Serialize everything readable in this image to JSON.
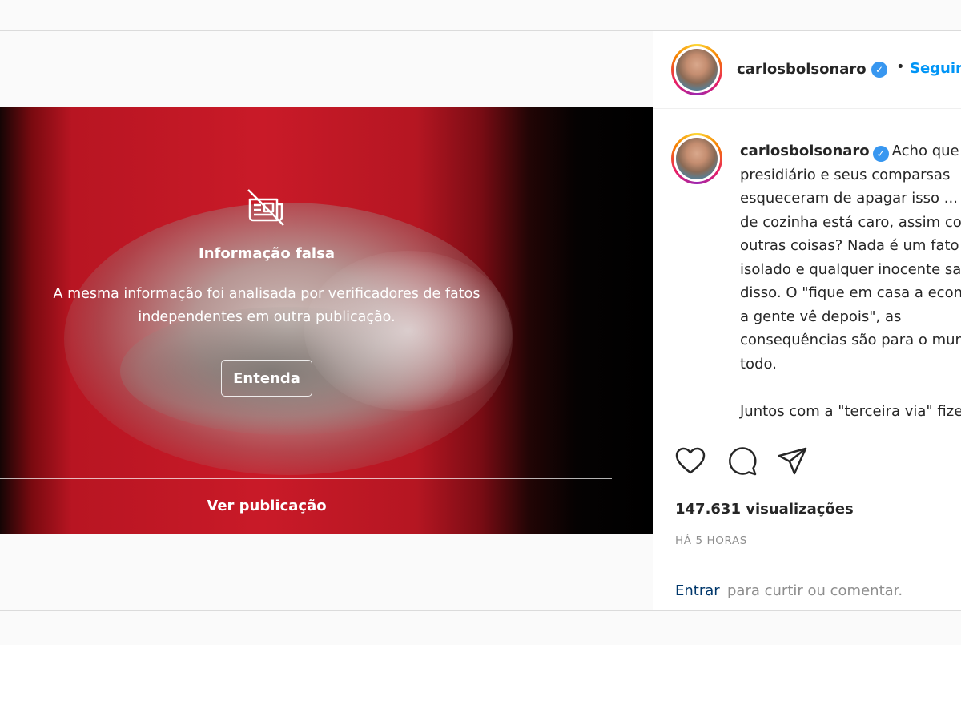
{
  "media": {
    "overlay_title": "Informação falsa",
    "overlay_description": "A mesma informação foi analisada por verificadores de fatos independentes em outra publicação.",
    "learn_button": "Entenda",
    "view_post": "Ver publicação",
    "icon": "false-info-icon"
  },
  "header": {
    "username": "carlosbolsonaro",
    "verified_icon": "verified-badge-icon",
    "separator": "•",
    "follow_label": "Seguir"
  },
  "caption": {
    "username": "carlosbolsonaro",
    "paragraph1": "Acho que o presidiário e seus comparsas esqueceram de apagar isso ... o gás de cozinha está caro, assim como outras coisas? Nada é um fato isolado e qualquer inocente sabe disso. O \"fique em casa a economia a gente vê depois\", as consequências são para o mundo todo.",
    "paragraph2": "Juntos com a \"terceira via\" fizeram tudo para destruir as fontes"
  },
  "actions": {
    "like_icon": "heart-icon",
    "comment_icon": "comment-icon",
    "share_icon": "share-icon",
    "views": "147.631 visualizações",
    "time": "HÁ 5 HORAS"
  },
  "login": {
    "link": "Entrar",
    "rest": "para curtir ou comentar."
  },
  "colors": {
    "link_blue": "#0095f6",
    "verified_blue": "#3897f0",
    "login_link": "#00376b",
    "muted_text": "#8e8e8e"
  }
}
